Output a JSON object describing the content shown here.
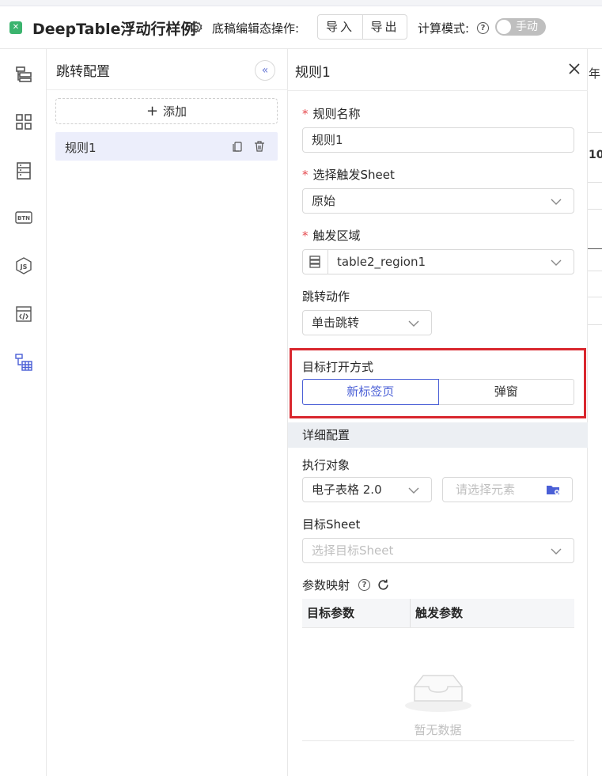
{
  "header": {
    "logo_glyph": "✕",
    "title": "DeepTable浮动行样例",
    "draft_label": "底稿编辑态操作:",
    "import_label": "导入",
    "export_label": "导出",
    "calc_label": "计算模式:",
    "calc_toggle_label": "手动"
  },
  "sidebar_icons": [
    "layout-icon",
    "grid-icon",
    "table-rows-icon",
    "btn-icon",
    "js-icon",
    "code-window-icon",
    "jump-table-icon"
  ],
  "config_panel": {
    "title": "跳转配置",
    "add_label": "添加",
    "rules": [
      {
        "label": "规则1"
      }
    ]
  },
  "detail": {
    "title": "规则1",
    "rule_name_label": "规则名称",
    "rule_name_value": "规则1",
    "trigger_sheet_label": "选择触发Sheet",
    "trigger_sheet_value": "原始",
    "trigger_region_label": "触发区域",
    "trigger_region_value": "table2_region1",
    "jump_action_label": "跳转动作",
    "jump_action_value": "单击跳转",
    "open_mode_label": "目标打开方式",
    "open_mode_options": [
      "新标签页",
      "弹窗"
    ],
    "open_mode_selected": "新标签页",
    "section_title": "详细配置",
    "exec_target_label": "执行对象",
    "exec_target_value": "电子表格 2.0",
    "element_placeholder": "请选择元素",
    "target_sheet_label": "目标Sheet",
    "target_sheet_placeholder": "选择目标Sheet",
    "param_mapping_label": "参数映射",
    "table_headers": [
      "目标参数",
      "触发参数"
    ],
    "empty_text": "暂无数据"
  },
  "sheet_edge": {
    "col_header": "年",
    "cell_value": "10"
  },
  "colors": {
    "accent": "#4a5fd6",
    "highlight_border": "#d9272e",
    "required": "#e5484d"
  }
}
